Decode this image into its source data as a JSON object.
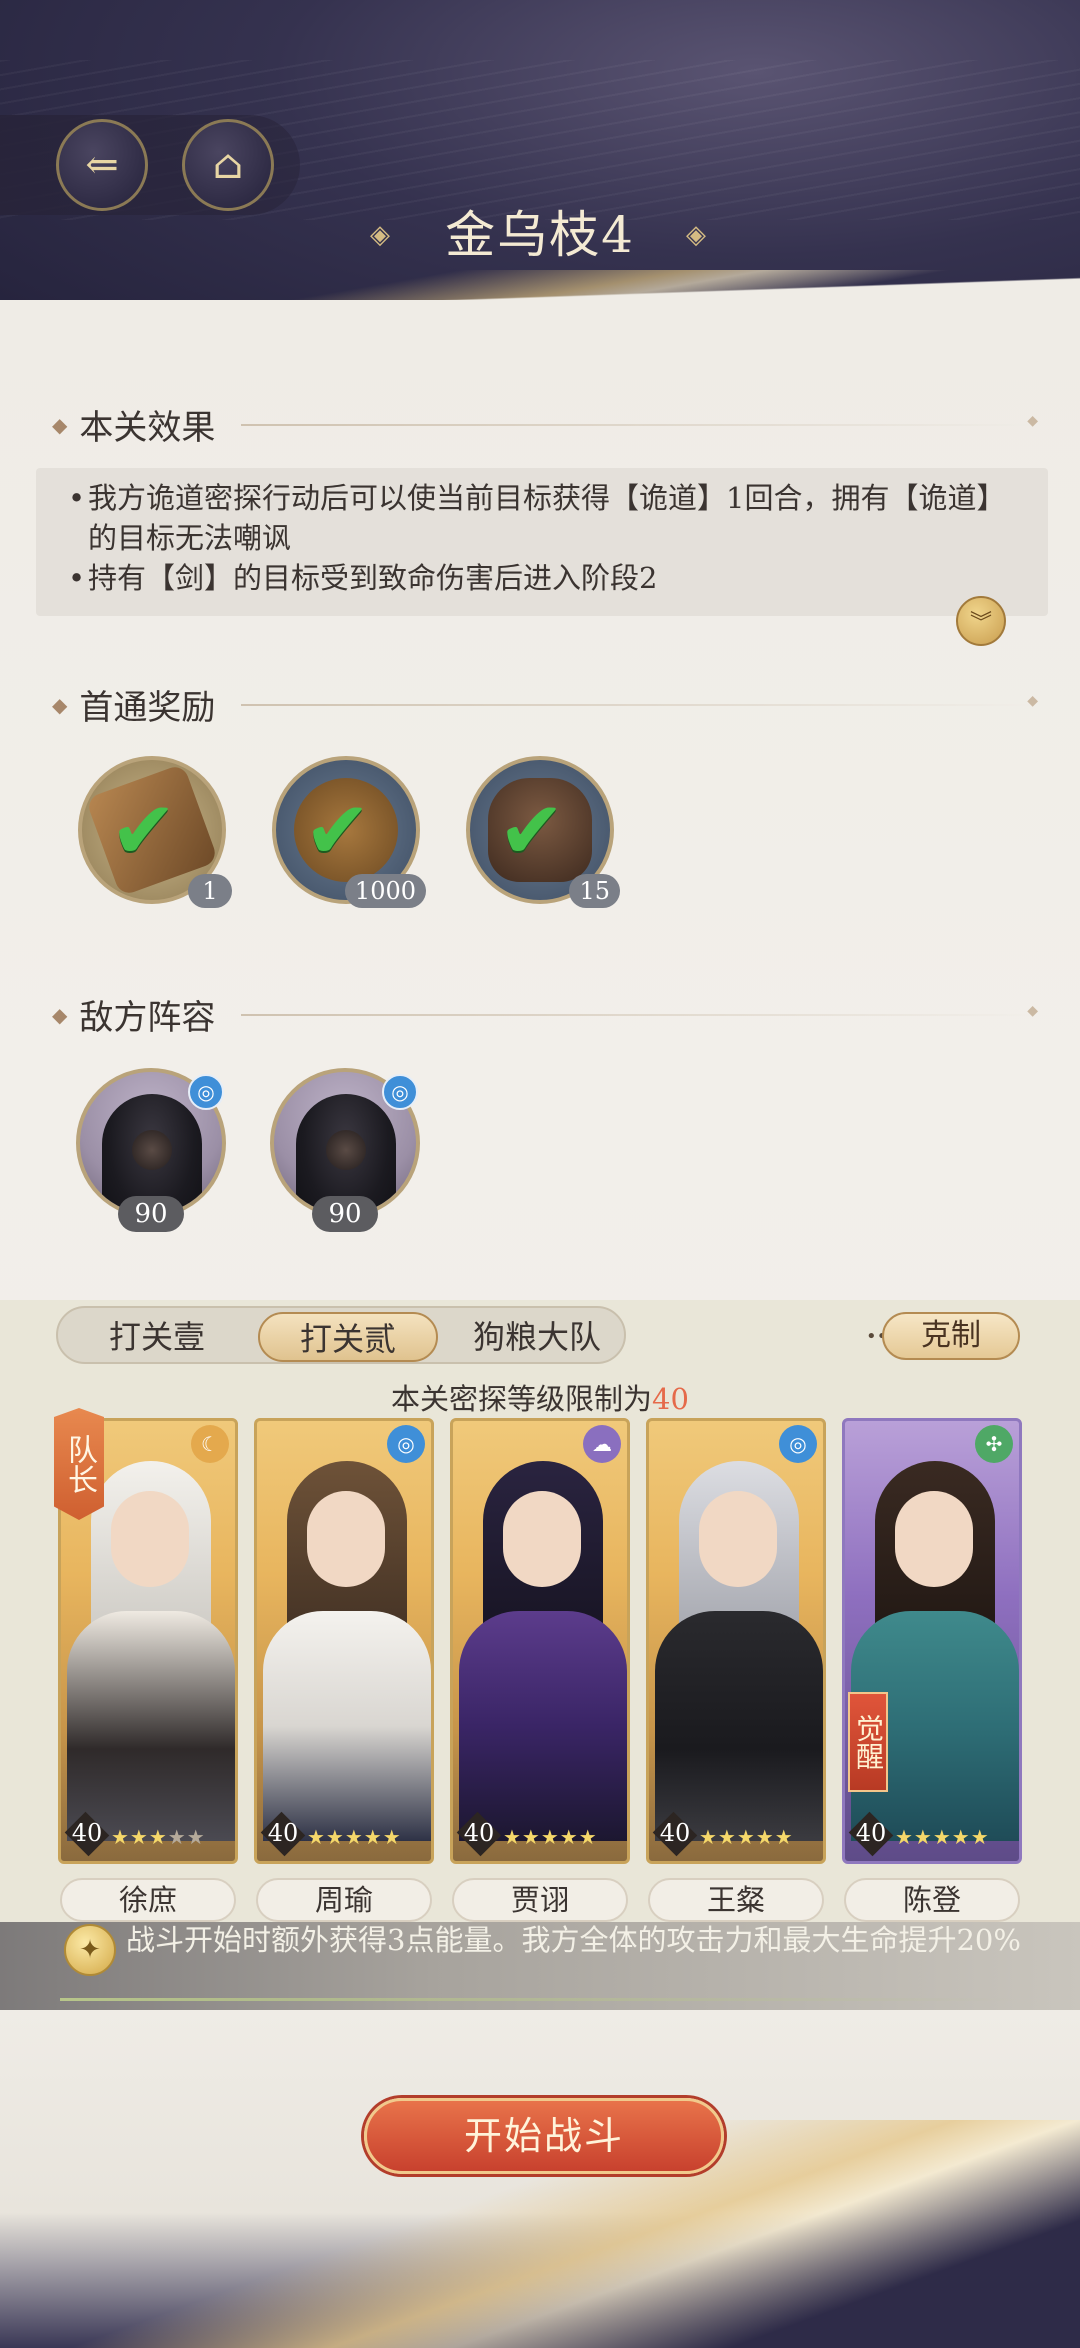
{
  "header": {
    "back_icon": "back-arrow-icon",
    "home_icon": "pavilion-icon",
    "title": "金乌枝4"
  },
  "effects": {
    "heading": "本关效果",
    "lines": [
      "我方诡道密探行动后可以使当前目标获得【诡道】1回合，拥有【诡道】的目标无法嘲讽",
      "持有【剑】的目标受到致命伤害后进入阶段2"
    ],
    "expand_icon": "double-chevron-down-icon"
  },
  "rewards": {
    "heading": "首通奖励",
    "items": [
      {
        "icon": "token-plaque-icon",
        "qty": "1",
        "claimed": true
      },
      {
        "icon": "coin-dragon-icon",
        "qty": "1000",
        "claimed": true
      },
      {
        "icon": "wine-jar-icon",
        "qty": "15",
        "claimed": true
      }
    ]
  },
  "enemies": {
    "heading": "敌方阵容",
    "items": [
      {
        "icon": "hooded-figure-icon",
        "level": "90",
        "element": "swirl-icon"
      },
      {
        "icon": "hooded-figure-icon",
        "level": "90",
        "element": "swirl-icon"
      }
    ]
  },
  "team": {
    "tabs": [
      "打关壹",
      "打关贰",
      "狗粮大队"
    ],
    "active_tab": 1,
    "counter_label": "克制",
    "limit_prefix": "本关密探等级限制为",
    "limit_value": "40",
    "captain_label": "队长",
    "awaken_label": "觉醒",
    "members": [
      {
        "name": "徐庶",
        "level": "40",
        "stars": 3,
        "element": "moon-icon",
        "element_color": "#e4a94d",
        "frame": "gold"
      },
      {
        "name": "周瑜",
        "level": "40",
        "stars": 5,
        "element": "swirl-icon",
        "element_color": "#3f8fd8",
        "frame": "gold"
      },
      {
        "name": "贾诩",
        "level": "40",
        "stars": 5,
        "element": "cloud-icon",
        "element_color": "#8a6fbf",
        "frame": "gold"
      },
      {
        "name": "王粲",
        "level": "40",
        "stars": 5,
        "element": "swirl-icon",
        "element_color": "#3f8fd8",
        "frame": "gold"
      },
      {
        "name": "陈登",
        "level": "40",
        "stars": 5,
        "element": "leaf-icon",
        "element_color": "#4fa866",
        "frame": "purple"
      }
    ]
  },
  "buff": {
    "icon": "energy-medal-icon",
    "text": "战斗开始时额外获得3点能量。我方全体的攻击力和最大生命提升20%"
  },
  "start_button": "开始战斗"
}
